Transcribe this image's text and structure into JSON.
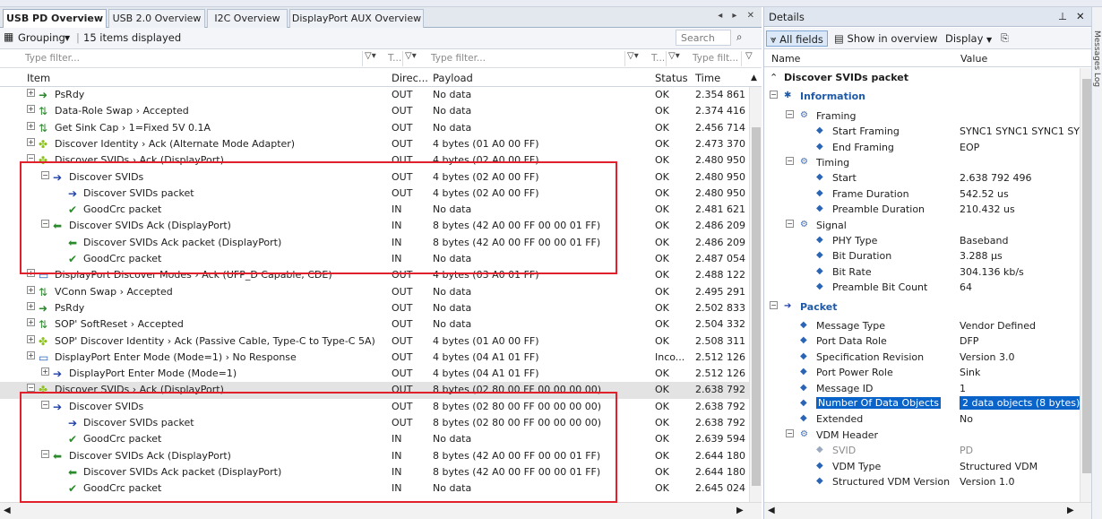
{
  "tabs": [
    {
      "label": "USB PD Overview",
      "active": true
    },
    {
      "label": "USB 2.0 Overview"
    },
    {
      "label": "I2C Overview"
    },
    {
      "label": "DisplayPort AUX Overview"
    }
  ],
  "tabs_controls": "◂ ▸ ✕",
  "toolbar": {
    "grouping_label": "Grouping",
    "items_count": "15 items displayed",
    "search_placeholder": "Search"
  },
  "filters": {
    "type_filter": "Type filter...",
    "type_filter_short": "Type filt...",
    "t_short": "T..."
  },
  "columns": {
    "item": "Item",
    "direction": "Direc...",
    "payload": "Payload",
    "status": "Status",
    "time": "Time"
  },
  "rows": [
    {
      "label": "PsRdy",
      "dir": "OUT",
      "payload": "No data",
      "status": "OK",
      "time": "2.354 861 8"
    },
    {
      "label": "Data-Role Swap › Accepted",
      "dir": "OUT",
      "payload": "No data",
      "status": "OK",
      "time": "2.374 416 6"
    },
    {
      "label": "Get Sink Cap › 1=Fixed 5V 0.1A",
      "dir": "OUT",
      "payload": "No data",
      "status": "OK",
      "time": "2.456 714 4"
    },
    {
      "label": "Discover Identity › Ack (Alternate Mode Adapter)",
      "dir": "OUT",
      "payload": "4 bytes (01 A0 00 FF)",
      "status": "OK",
      "time": "2.473 370 3"
    },
    {
      "label": "Discover SVIDs › Ack (DisplayPort)",
      "dir": "OUT",
      "payload": "4 bytes (02 A0 00 FF)",
      "status": "OK",
      "time": "2.480 950 5"
    },
    {
      "label": "Discover SVIDs",
      "dir": "OUT",
      "payload": "4 bytes (02 A0 00 FF)",
      "status": "OK",
      "time": "2.480 950 5"
    },
    {
      "label": "Discover SVIDs packet",
      "dir": "OUT",
      "payload": "4 bytes (02 A0 00 FF)",
      "status": "OK",
      "time": "2.480 950 5"
    },
    {
      "label": "GoodCrc packet",
      "dir": "IN",
      "payload": "No data",
      "status": "OK",
      "time": "2.481 621 0"
    },
    {
      "label": "Discover SVIDs Ack (DisplayPort)",
      "dir": "IN",
      "payload": "8 bytes (42 A0 00 FF 00 00 01 FF)",
      "status": "OK",
      "time": "2.486 209 0"
    },
    {
      "label": "Discover SVIDs Ack packet (DisplayPort)",
      "dir": "IN",
      "payload": "8 bytes (42 A0 00 FF 00 00 01 FF)",
      "status": "OK",
      "time": "2.486 209 0"
    },
    {
      "label": "GoodCrc packet",
      "dir": "IN",
      "payload": "No data",
      "status": "OK",
      "time": "2.487 054 2"
    },
    {
      "label": "DisplayPort Discover Modes › Ack (UFP_D Capable, CDE)",
      "dir": "OUT",
      "payload": "4 bytes (03 A0 01 FF)",
      "status": "OK",
      "time": "2.488 122 7"
    },
    {
      "label": "VConn Swap › Accepted",
      "dir": "OUT",
      "payload": "No data",
      "status": "OK",
      "time": "2.495 291 4"
    },
    {
      "label": "PsRdy",
      "dir": "OUT",
      "payload": "No data",
      "status": "OK",
      "time": "2.502 833 8"
    },
    {
      "label": "SOP' SoftReset › Accepted",
      "dir": "OUT",
      "payload": "No data",
      "status": "OK",
      "time": "2.504 332 6"
    },
    {
      "label": "SOP' Discover Identity › Ack (Passive Cable, Type-C to Type-C 5A)",
      "dir": "OUT",
      "payload": "4 bytes (01 A0 00 FF)",
      "status": "OK",
      "time": "2.508 311 5"
    },
    {
      "label": "DisplayPort Enter Mode (Mode=1) › No Response",
      "dir": "OUT",
      "payload": "4 bytes (04 A1 01 FF)",
      "status": "Inco...",
      "time": "2.512 126 7"
    },
    {
      "label": "DisplayPort Enter Mode (Mode=1)",
      "dir": "OUT",
      "payload": "4 bytes (04 A1 01 FF)",
      "status": "OK",
      "time": "2.512 126 7"
    },
    {
      "label": "Discover SVIDs › Ack (DisplayPort)",
      "dir": "OUT",
      "payload": "8 bytes (02 80 00 FF 00 00 00 00)",
      "status": "OK",
      "time": "2.638 792 4"
    },
    {
      "label": "Discover SVIDs",
      "dir": "OUT",
      "payload": "8 bytes (02 80 00 FF 00 00 00 00)",
      "status": "OK",
      "time": "2.638 792 4"
    },
    {
      "label": "Discover SVIDs packet",
      "dir": "OUT",
      "payload": "8 bytes (02 80 00 FF 00 00 00 00)",
      "status": "OK",
      "time": "2.638 792 4"
    },
    {
      "label": "GoodCrc packet",
      "dir": "IN",
      "payload": "No data",
      "status": "OK",
      "time": "2.639 594 3"
    },
    {
      "label": "Discover SVIDs Ack (DisplayPort)",
      "dir": "IN",
      "payload": "8 bytes (42 A0 00 FF 00 00 01 FF)",
      "status": "OK",
      "time": "2.644 180 0"
    },
    {
      "label": "Discover SVIDs Ack packet (DisplayPort)",
      "dir": "IN",
      "payload": "8 bytes (42 A0 00 FF 00 00 01 FF)",
      "status": "OK",
      "time": "2.644 180 0"
    },
    {
      "label": "GoodCrc packet",
      "dir": "IN",
      "payload": "No data",
      "status": "OK",
      "time": "2.645 024 7"
    }
  ],
  "details": {
    "title": "Details",
    "toolbar": {
      "all_fields": "All fields",
      "show_overview": "Show in overview",
      "display": "Display"
    },
    "headers": {
      "name": "Name",
      "value": "Value"
    },
    "side_tab": "Messages Log",
    "rows": [
      {
        "name": "Discover SVIDs packet",
        "value": ""
      },
      {
        "name": "Information",
        "value": ""
      },
      {
        "name": "Framing",
        "value": ""
      },
      {
        "name": "Start Framing",
        "value": "SYNC1 SYNC1 SYNC1 SYNC2"
      },
      {
        "name": "End Framing",
        "value": "EOP"
      },
      {
        "name": "Timing",
        "value": ""
      },
      {
        "name": "Start",
        "value": "2.638 792 496"
      },
      {
        "name": "Frame Duration",
        "value": "542.52 us"
      },
      {
        "name": "Preamble Duration",
        "value": "210.432 us"
      },
      {
        "name": "Signal",
        "value": ""
      },
      {
        "name": "PHY Type",
        "value": "Baseband"
      },
      {
        "name": "Bit Duration",
        "value": "3.288 µs"
      },
      {
        "name": "Bit Rate",
        "value": "304.136 kb/s"
      },
      {
        "name": "Preamble Bit Count",
        "value": "64"
      },
      {
        "name": "Packet",
        "value": ""
      },
      {
        "name": "Message Type",
        "value": "Vendor Defined"
      },
      {
        "name": "Port Data Role",
        "value": "DFP"
      },
      {
        "name": "Specification Revision",
        "value": "Version 3.0"
      },
      {
        "name": "Port Power Role",
        "value": "Sink"
      },
      {
        "name": "Message ID",
        "value": "1"
      },
      {
        "name": "Number Of Data Objects",
        "value": "2 data objects (8 bytes)"
      },
      {
        "name": "Extended",
        "value": "No"
      },
      {
        "name": "VDM Header",
        "value": ""
      },
      {
        "name": "SVID",
        "value": "PD"
      },
      {
        "name": "VDM Type",
        "value": "Structured VDM"
      },
      {
        "name": "Structured VDM Version",
        "value": "Version 1.0"
      }
    ]
  },
  "colors": {
    "highlight": "#0a63c9",
    "redbox": "#e0202a",
    "section": "#1e5aa8"
  }
}
